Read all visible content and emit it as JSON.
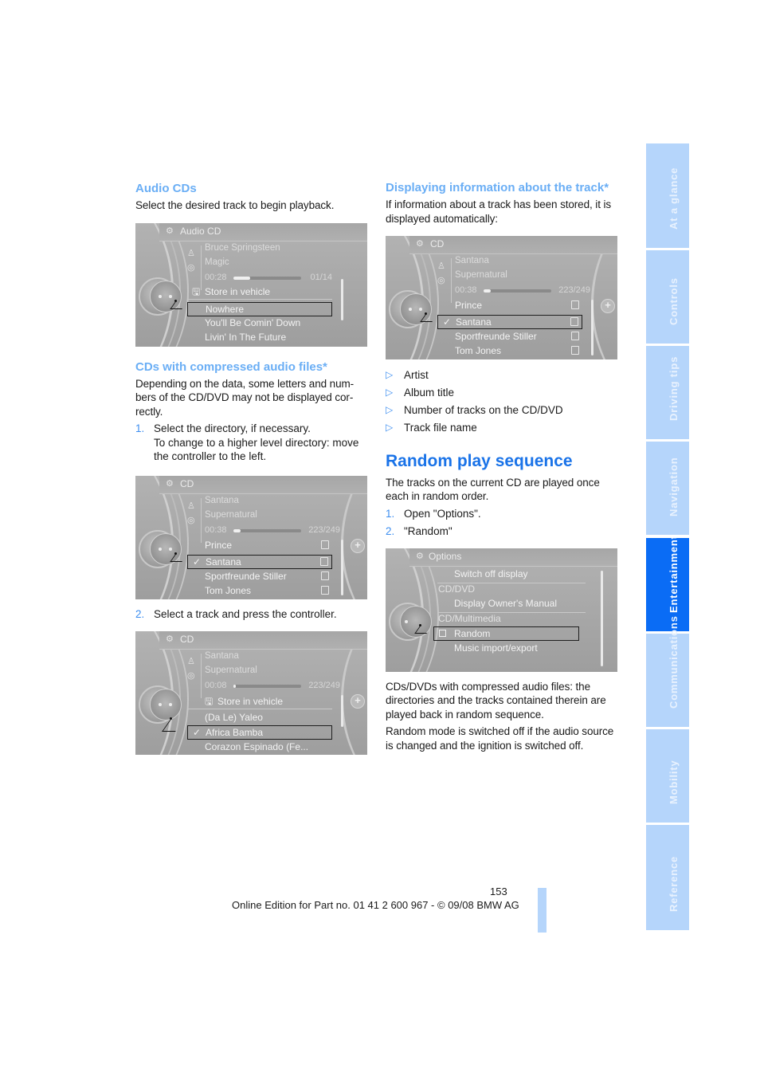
{
  "left_column": {
    "audio_cds": {
      "heading": "Audio CDs",
      "text": "Select the desired track to begin playback."
    },
    "screen1": {
      "title": "Audio CD",
      "artist": "Bruce Springsteen",
      "album": "Magic",
      "time": "00:28",
      "progress_fraction": 0.25,
      "track_count": "01/14",
      "rows": [
        {
          "label": "Store in vehicle",
          "icon": "floppy-disk-icon",
          "selected": false,
          "divider": false
        },
        {
          "label": "Nowhere",
          "icon": "",
          "selected": true
        },
        {
          "label": "You'll Be Comin' Down",
          "icon": "",
          "selected": false
        },
        {
          "label": "Livin' In The Future",
          "icon": "",
          "selected": false
        }
      ]
    },
    "compressed": {
      "heading": "CDs with compressed audio files*",
      "text": "Depending on the data, some letters and num-bers of the CD/DVD may not be displayed cor-rectly.",
      "step1_num": "1.",
      "step1_text": "Select the directory, if necessary.",
      "step1_sub": "To change to a higher level directory: move the controller to the left.",
      "step2_num": "2.",
      "step2_text": "Select a track and press the controller."
    },
    "screen2": {
      "title": "CD",
      "artist": "Santana",
      "album": "Supernatural",
      "time": "00:38",
      "progress_fraction": 0.1,
      "track_count": "223/249",
      "rows": [
        {
          "label": "Prince",
          "checked": false,
          "selected": false
        },
        {
          "label": "Santana",
          "checked": true,
          "selected": true
        },
        {
          "label": "Sportfreunde Stiller",
          "checked": false,
          "selected": false
        },
        {
          "label": "Tom Jones",
          "checked": false,
          "selected": false
        }
      ]
    },
    "screen3": {
      "title": "CD",
      "artist": "Santana",
      "album": "Supernatural",
      "time": "00:08",
      "progress_fraction": 0.02,
      "track_count": "223/249",
      "rows": [
        {
          "label": "Store in vehicle",
          "icon": "floppy-disk-icon",
          "checked": false,
          "selected": false
        },
        {
          "label": "(Da Le) Yaleo",
          "checked": false,
          "selected": false
        },
        {
          "label": "Africa Bamba",
          "checked": true,
          "selected": true
        },
        {
          "label": "Corazon Espinado (Fe...",
          "checked": false,
          "selected": false
        }
      ]
    }
  },
  "right_column": {
    "display_info": {
      "heading": "Displaying information about the track*",
      "text": "If information about a track has been stored, it is displayed automatically:"
    },
    "screen4": {
      "title": "CD",
      "artist": "Santana",
      "album": "Supernatural",
      "time": "00:38",
      "progress_fraction": 0.1,
      "track_count": "223/249",
      "rows": [
        {
          "label": "Prince",
          "checked": false,
          "selected": false
        },
        {
          "label": "Santana",
          "checked": true,
          "selected": true
        },
        {
          "label": "Sportfreunde Stiller",
          "checked": false,
          "selected": false
        },
        {
          "label": "Tom Jones",
          "checked": false,
          "selected": false
        }
      ]
    },
    "bullets": [
      "Artist",
      "Album title",
      "Number of tracks on the CD/DVD",
      "Track file name"
    ],
    "random": {
      "heading": "Random play sequence",
      "text": "The tracks on the current CD are played once each in random order.",
      "step1_num": "1.",
      "step1_text": "Open \"Options\".",
      "step2_num": "2.",
      "step2_text": "\"Random\"",
      "note1": "CDs/DVDs with compressed audio files: the directories and the tracks contained therein are played back in random sequence.",
      "note2": "Random mode is switched off if the audio source is changed and the ignition is switched off."
    },
    "screen5": {
      "title": "Options",
      "items": [
        {
          "type": "item",
          "label": "Switch off display"
        },
        {
          "type": "category",
          "label": "CD/DVD"
        },
        {
          "type": "item",
          "label": "Display Owner's Manual"
        },
        {
          "type": "category",
          "label": "CD/Multimedia"
        },
        {
          "type": "checkbox",
          "label": "Random",
          "checked": false,
          "selected": true
        },
        {
          "type": "item",
          "label": "Music import/export"
        }
      ]
    }
  },
  "side_tabs": [
    {
      "label": "At a glance",
      "active": false
    },
    {
      "label": "Controls",
      "active": false
    },
    {
      "label": "Driving tips",
      "active": false
    },
    {
      "label": "Navigation",
      "active": false
    },
    {
      "label": "Entertainment",
      "active": true
    },
    {
      "label": "Communications",
      "active": false
    },
    {
      "label": "Mobility",
      "active": false
    },
    {
      "label": "Reference",
      "active": false
    }
  ],
  "footer": {
    "page_number": "153",
    "text": "Online Edition for Part no. 01 41 2 600 967  - © 09/08 BMW AG"
  },
  "colors": {
    "subheading": "#6aaef5",
    "heading": "#1a73e8",
    "tab_inactive": "#b5d5fb",
    "tab_active": "#0a6cf5"
  }
}
